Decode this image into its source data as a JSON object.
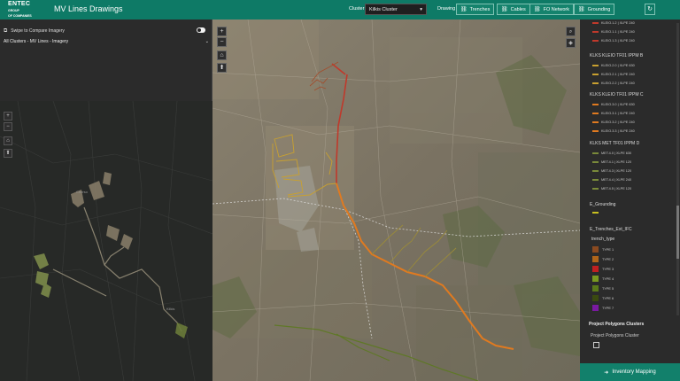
{
  "header": {
    "logo_main": "ENTEC",
    "logo_sub1": "GROUP",
    "logo_sub2": "OF COMPANIES",
    "title": "MV Lines Drawings",
    "cluster_label": "Cluster",
    "cluster_value": "Kilkis Cluster",
    "drawing_label": "Drawing",
    "buttons": [
      {
        "label": "Trenches",
        "icon": "link-icon"
      },
      {
        "label": "Cables",
        "icon": "link-icon"
      },
      {
        "label": "FO Network",
        "icon": "link-icon"
      },
      {
        "label": "Grounding",
        "icon": "link-icon"
      }
    ],
    "refresh_icon": "refresh-icon"
  },
  "left_panel": {
    "swipe_label": "Swipe to Compare Imagery",
    "layer_label": "All Clusters - MV Lines - Imagery",
    "mini_labels": [
      "Cherso",
      "Kilkis"
    ]
  },
  "legend": {
    "top_items": [
      {
        "label": "KLEIO.1.2 | XLPE 240",
        "color": "#c0392b"
      },
      {
        "label": "KLEIO.1.1 | XLPE 240",
        "color": "#c0392b"
      },
      {
        "label": "KLEIO.1.3 | XLPE 240",
        "color": "#c0392b"
      }
    ],
    "groups": [
      {
        "title": "KLKS KLEIO TF01 IPPM B",
        "items": [
          {
            "label": "KLEIO.2.0 | XLPE 630",
            "color": "#c8a030"
          },
          {
            "label": "KLEIO.2.1 | XLPE 240",
            "color": "#c8a030"
          },
          {
            "label": "KLEIO.2.2 | XLPE 240",
            "color": "#c8a030"
          }
        ]
      },
      {
        "title": "KLKS KLEIO TF01 IPPM C",
        "items": [
          {
            "label": "KLEIO.3.0 | XLPE 630",
            "color": "#e07a20"
          },
          {
            "label": "KLEIO.3.1 | XLPE 240",
            "color": "#e07a20"
          },
          {
            "label": "KLEIO.3.2 | XLPE 240",
            "color": "#e07a20"
          },
          {
            "label": "KLEIO.3.3 | XLPE 240",
            "color": "#e07a20"
          }
        ]
      },
      {
        "title": "KLKS MET TF01 IPPM D",
        "items": [
          {
            "label": "MET.4.0 | XLPE 630",
            "color": "#7a8a3a"
          },
          {
            "label": "MET.4.1 | XLPE 120",
            "color": "#7a8a3a"
          },
          {
            "label": "MET.4.3 | XLPE 120",
            "color": "#7a8a3a"
          },
          {
            "label": "MET.4.4 | XLPE 240",
            "color": "#7a8a3a"
          },
          {
            "label": "MET.4.5 | XLPE 120",
            "color": "#7a8a3a"
          }
        ]
      }
    ],
    "grounding_title": "E_Grounding",
    "grounding_color": "#c8c020",
    "trenches_title": "E_Trenches_Ext_IFC",
    "trench_type_label": "trench_type",
    "trench_types": [
      {
        "label": "TYPE 1",
        "color": "#8a4a20"
      },
      {
        "label": "TYPE 2",
        "color": "#b0651a"
      },
      {
        "label": "TYPE 3",
        "color": "#c02020"
      },
      {
        "label": "TYPE 4",
        "color": "#7a9a20"
      },
      {
        "label": "TYPE 5",
        "color": "#5a7a1a"
      },
      {
        "label": "TYPE 6",
        "color": "#3a4a10"
      },
      {
        "label": "TYPE 7",
        "color": "#7a1aa0"
      }
    ]
  },
  "project_polygons": {
    "heading": "Project Polygons Clusters",
    "label": "Project Polygons Cluster"
  },
  "inventory_button": "Inventory Mapping"
}
